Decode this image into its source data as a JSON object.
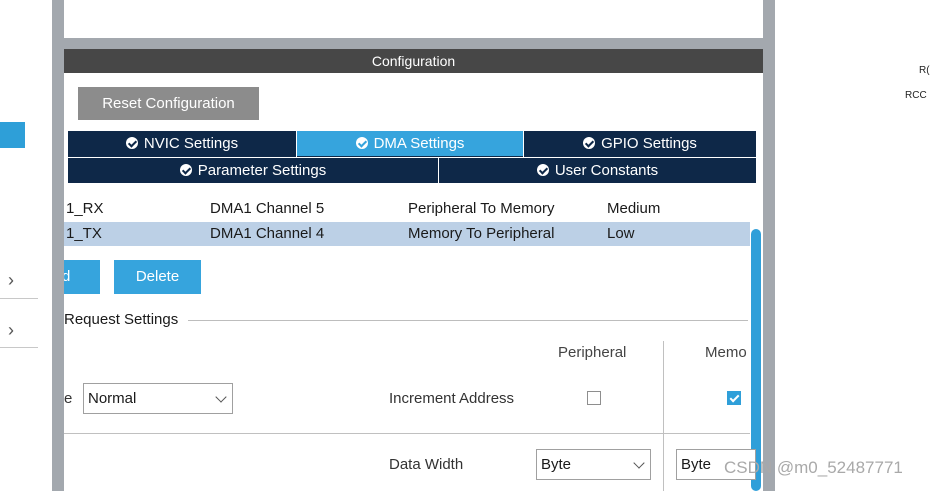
{
  "config_panel": {
    "title": "Configuration",
    "reset_label": "Reset Configuration"
  },
  "tabs": [
    {
      "label": "NVIC Settings",
      "active": false
    },
    {
      "label": "DMA Settings",
      "active": true
    },
    {
      "label": "GPIO Settings",
      "active": false
    },
    {
      "label": "Parameter Settings",
      "active": false
    },
    {
      "label": "User Constants",
      "active": false
    }
  ],
  "dma_table": {
    "rows": [
      {
        "request": "1_RX",
        "channel": "DMA1 Channel 5",
        "direction": "Peripheral To Memory",
        "priority": "Medium",
        "selected": false
      },
      {
        "request": "1_TX",
        "channel": "DMA1 Channel 4",
        "direction": "Memory To Peripheral",
        "priority": "Low",
        "selected": true
      }
    ]
  },
  "buttons": {
    "add_label": "d",
    "delete_label": "Delete"
  },
  "request_settings": {
    "title": "Request Settings",
    "col_peripheral": "Peripheral",
    "col_memory": "Memo",
    "mode_prefix": "e",
    "mode_value": "Normal",
    "increment_label": "Increment Address",
    "peripheral_increment": false,
    "memory_increment": true,
    "data_width_label": "Data Width",
    "peripheral_width": "Byte",
    "memory_width": "Byte"
  },
  "right_side": {
    "text1": "R(",
    "text2": "RCC"
  },
  "watermark": "CSDN @m0_52487771",
  "colors": {
    "accent": "#36a4dd",
    "tab_bar": "#0e2848",
    "header": "#474747",
    "selected_row": "#bcd0e6"
  }
}
